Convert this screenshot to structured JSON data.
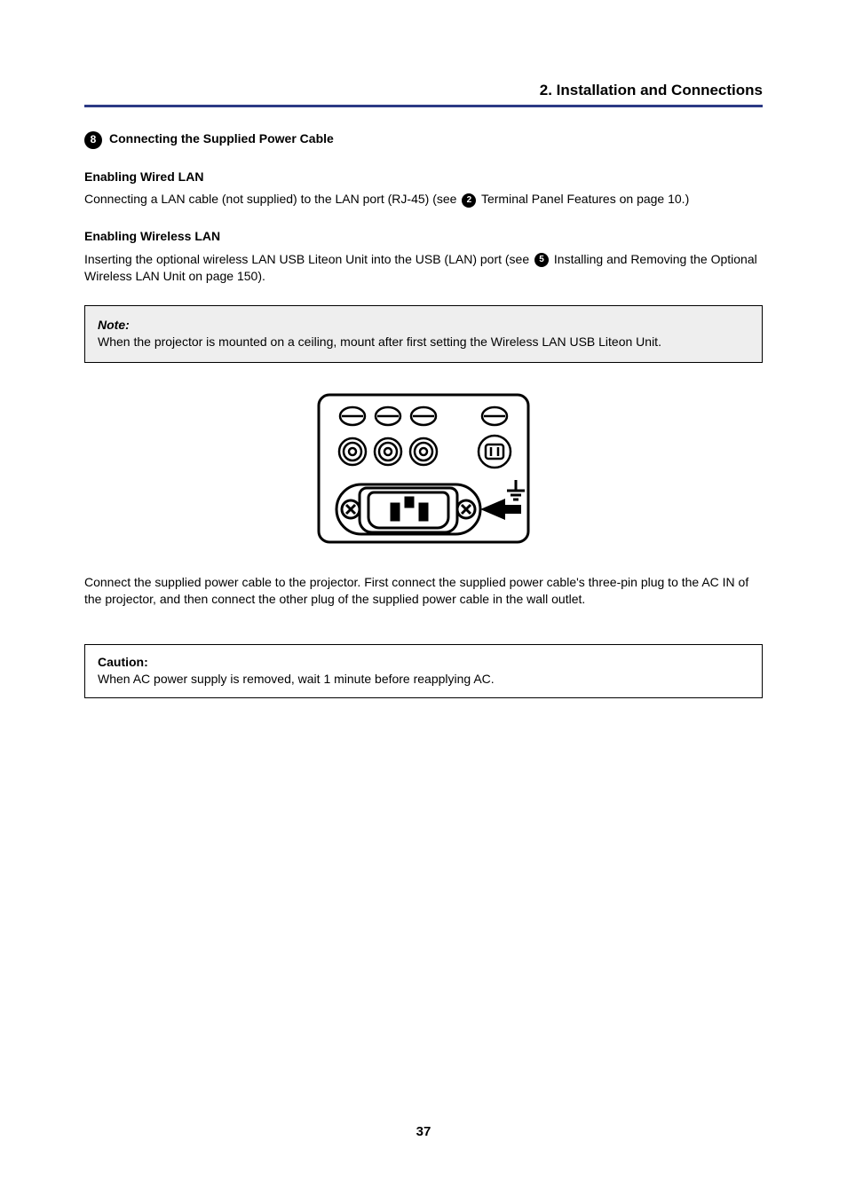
{
  "chapter_header": "2. Installation and Connections",
  "step8": {
    "num": "8",
    "title": "Connecting the Supplied Power Cable"
  },
  "sec_lan": {
    "title": "Enabling Wired LAN",
    "text_a": "Connecting a LAN cable (not supplied) to the LAN port (RJ-45) (see ",
    "text_b": " Terminal Panel Features on page 10.)"
  },
  "sec_wlan": {
    "title": "Enabling Wireless LAN",
    "text_a": "Inserting the optional wireless LAN USB Liteon Unit into the USB (LAN) port (see ",
    "text_b": " Installing and Removing the Optional Wireless LAN Unit on page 150)."
  },
  "note": {
    "label": "Note:",
    "text": "When the projector is mounted on a ceiling, mount after first setting the Wireless LAN USB Liteon Unit."
  },
  "sec_power": {
    "text": "Connect the supplied power cable to the projector. First connect the supplied power cable's three-pin plug to the AC IN of the projector, and then connect the other plug of the supplied power cable in the wall outlet."
  },
  "caution": {
    "label": "Caution:",
    "text": "When AC power supply is removed, wait 1 minute before reapplying AC."
  },
  "circ2": "2",
  "circ5": "5",
  "page_number": "37"
}
